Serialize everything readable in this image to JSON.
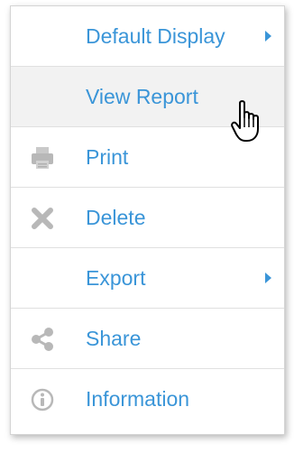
{
  "menu": {
    "items": [
      {
        "label": "Default Display",
        "icon": "none",
        "has_submenu": true
      },
      {
        "label": "View Report",
        "icon": "none",
        "has_submenu": false,
        "hovered": true
      },
      {
        "label": "Print",
        "icon": "printer-icon",
        "has_submenu": false
      },
      {
        "label": "Delete",
        "icon": "x-close-icon",
        "has_submenu": false
      },
      {
        "label": "Export",
        "icon": "none",
        "has_submenu": true
      },
      {
        "label": "Share",
        "icon": "share-icon",
        "has_submenu": false
      },
      {
        "label": "Information",
        "icon": "info-circle-icon",
        "has_submenu": false
      }
    ]
  },
  "colors": {
    "label": "#3a95d8",
    "icon": "#b8b8b8",
    "hover_background": "#f2f2f2",
    "divider": "#e0e0e0"
  }
}
